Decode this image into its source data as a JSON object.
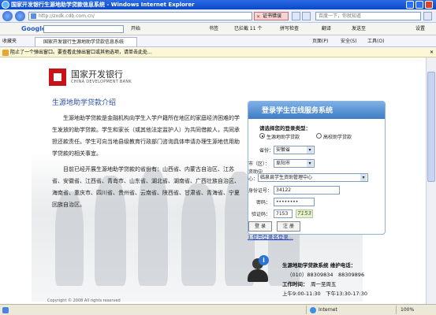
{
  "window": {
    "title": "国家开发银行生源地助学贷款信息系统 - Windows Internet Explorer"
  },
  "address_bar": {
    "url": "http://zxdk.cdb.com.cn/",
    "cert_error": "证书错误",
    "search_placeholder": "百度一下，你就知道"
  },
  "google_toolbar": {
    "logo": "Google",
    "items": [
      "开始",
      "书签",
      "已拦截 11 个",
      "拼写检查",
      "翻译",
      "发送至",
      "设置"
    ]
  },
  "tabs": {
    "favorites": "收藏夹",
    "active_tab": "国家开发银行生源地助学贷款信息系统",
    "right_tools": [
      "页面(P)",
      "安全(S)",
      "工具(O)"
    ]
  },
  "infobar": {
    "text": "阻止了一个弹出窗口。要查看此弹出窗口或其他选项，请单击此处..."
  },
  "page": {
    "logo_cn": "国家开发银行",
    "logo_en": "CHINA DEVELOPMENT BANK",
    "intro_title": "生源地助学贷款介绍",
    "intro_p1": "生源地助学贷款是金融机构向学生入学户籍所在地区的家庭经济困难的学生发放的助学贷款。学生和家长（或其他法定监护人）为共同借款人，共同承担还款责任。学生可向当地县级教育行政部门咨询具体申请办理生源地信用助学贷款的相关事宜。",
    "intro_p2": "目前已经开展生源地助学贷款的省份有：山西省、内蒙古自治区、江苏省、安徽省、江西省、青岛市、山东省、湖北省、湖南省、广西壮族自治区、海南省、重庆市、四川省、贵州省、云南省、陕西省、甘肃省、青海省、宁夏回族自治区。",
    "copyright": "Copyright © 2008 All rights reserved"
  },
  "login": {
    "header": "登录学生在线服务系统",
    "choose_type": "请选择您的登录类型：",
    "type_options": [
      "生源地助学贷款",
      "高校助学贷款"
    ],
    "province_label": "省份：",
    "province_value": "安徽省",
    "city_label": "市（区）：",
    "city_value": "阜阳市",
    "center_label_line1": "资助中",
    "center_label_line2": "心：",
    "center_value": "临泉县学生资助管理中心",
    "id_label": "身份证号：",
    "id_value": "34122",
    "password_label": "密码：",
    "password_value": "••••••••",
    "captcha_label": "验证码：",
    "captcha_value": "7153",
    "captcha_image_text": "7153",
    "login_button": "登 录",
    "register_button": "注 册",
    "help_link": "1.使用登录名登录..."
  },
  "support": {
    "title": "生源地助学贷款系统 维护电话：",
    "phone": "（010）88309834　88309896",
    "hours_label": "工作时间：",
    "hours_days": "周一至周五",
    "hours_time": "上午9:00-11:30　下午13:30-17:30"
  },
  "statusbar": {
    "zone": "Internet",
    "zoom": "100%"
  }
}
